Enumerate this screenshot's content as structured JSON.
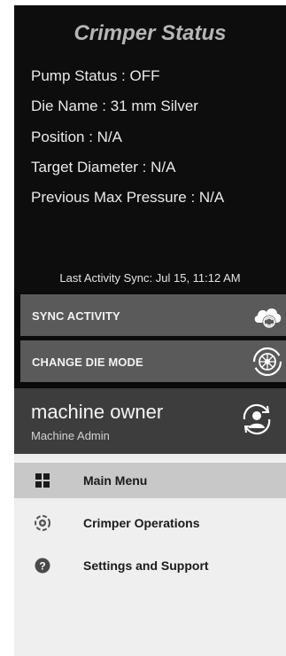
{
  "header": {
    "title": "Crimper Status"
  },
  "status": {
    "pump": "Pump Status : OFF",
    "die_name": "Die Name : 31 mm Silver",
    "position": "Position : N/A",
    "target_diameter": "Target Diameter :  N/A",
    "previous_max_pressure": "Previous Max Pressure : N/A",
    "last_sync": "Last Activity Sync: Jul 15, 11:12 AM"
  },
  "actions": {
    "sync_label": "SYNC ACTIVITY",
    "sync_icon": "cloud-sync-icon",
    "change_die_label": "CHANGE DIE MODE",
    "change_die_icon": "die-refresh-icon"
  },
  "user": {
    "name": "machine owner",
    "role": "Machine Admin",
    "icon": "switch-user-icon"
  },
  "menu": {
    "items": [
      {
        "label": "Main Menu",
        "icon": "grid-icon",
        "active": true
      },
      {
        "label": "Crimper Operations",
        "icon": "crimper-icon",
        "active": false
      },
      {
        "label": "Settings and Support",
        "icon": "help-icon",
        "active": false
      }
    ]
  },
  "colors": {
    "panel": "#0d0d0d",
    "button": "#5a5a5a",
    "user_panel": "#3d3d3d",
    "menu_bg": "#efefef",
    "menu_active": "#c8c8c8"
  }
}
